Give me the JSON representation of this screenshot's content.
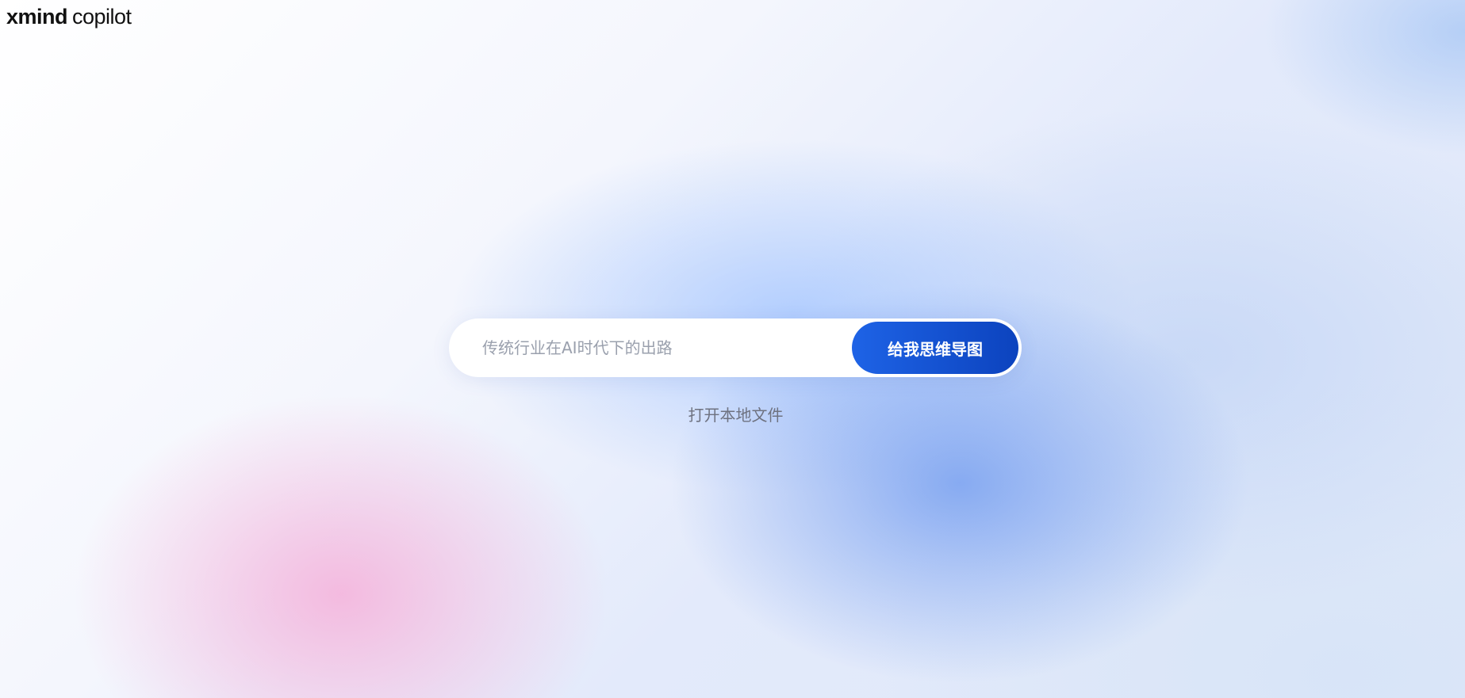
{
  "header": {
    "logo_brand": "xmind",
    "logo_product": "copilot"
  },
  "search": {
    "placeholder": "传统行业在AI时代下的出路",
    "value": "",
    "submit_label": "给我思维导图"
  },
  "links": {
    "open_local": "打开本地文件"
  },
  "colors": {
    "accent": "#1a56db",
    "accent_dark": "#0c43be",
    "background_pink": "#f4b4dc",
    "background_blue": "#78a0f0"
  }
}
